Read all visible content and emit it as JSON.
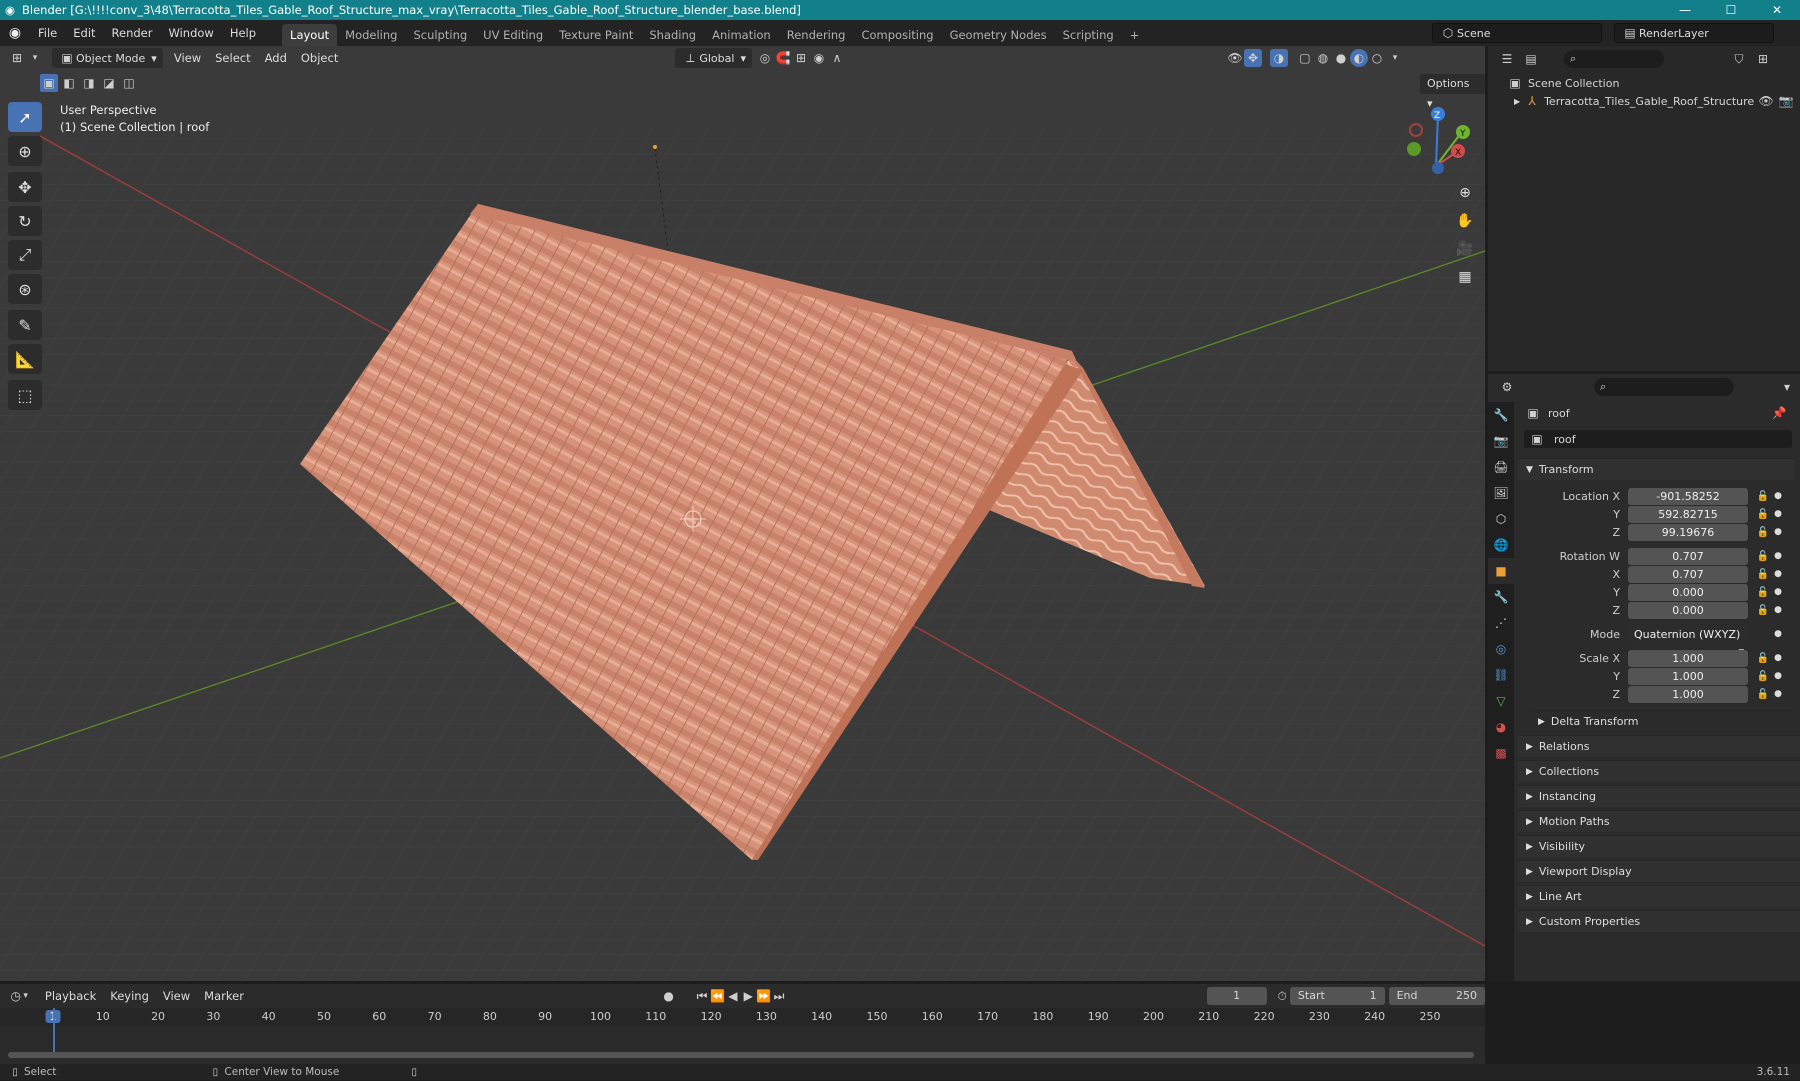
{
  "window": {
    "title": "Blender [G:\\!!!!conv_3\\48\\Terracotta_Tiles_Gable_Roof_Structure_max_vray\\Terracotta_Tiles_Gable_Roof_Structure_blender_base.blend]",
    "minimize": "—",
    "maximize": "☐",
    "close": "✕"
  },
  "menu": [
    "File",
    "Edit",
    "Render",
    "Window",
    "Help"
  ],
  "workspaces": [
    "Layout",
    "Modeling",
    "Sculpting",
    "UV Editing",
    "Texture Paint",
    "Shading",
    "Animation",
    "Rendering",
    "Compositing",
    "Geometry Nodes",
    "Scripting"
  ],
  "add_workspace": "+",
  "scene": "Scene",
  "render_layer": "RenderLayer",
  "viewport": {
    "mode": "Object Mode",
    "menus": [
      "View",
      "Select",
      "Add",
      "Object"
    ],
    "orientation": "Global",
    "options": "Options",
    "info_line1": "User Perspective",
    "info_line2": "(1) Scene Collection | roof"
  },
  "gizmo": {
    "z": "Z",
    "y": "Y",
    "x": "X"
  },
  "outliner": {
    "scene_collection": "Scene Collection",
    "object": "Terracotta_Tiles_Gable_Roof_Structure"
  },
  "properties": {
    "object_name": "roof",
    "data_name": "roof",
    "transform_title": "Transform",
    "location_label": "Location X",
    "loc_x": "-901.58252",
    "loc_y": "592.82715",
    "loc_z": "99.19676",
    "rotation_label": "Rotation W",
    "rot_w": "0.707",
    "rot_x": "0.707",
    "rot_y": "0.000",
    "rot_z": "0.000",
    "mode_label": "Mode",
    "mode_value": "Quaternion (WXYZ)",
    "scale_label": "Scale X",
    "scale_x": "1.000",
    "scale_y": "1.000",
    "scale_z": "1.000",
    "y": "Y",
    "z": "Z",
    "x": "X",
    "delta": "Delta Transform",
    "panels": [
      "Relations",
      "Collections",
      "Instancing",
      "Motion Paths",
      "Visibility",
      "Viewport Display",
      "Line Art",
      "Custom Properties"
    ]
  },
  "timeline": {
    "menus": [
      "Playback",
      "Keying",
      "View",
      "Marker"
    ],
    "current_frame": "1",
    "start_label": "Start",
    "start": "1",
    "end_label": "End",
    "end": "250",
    "ticks": [
      "1",
      "10",
      "20",
      "30",
      "40",
      "50",
      "60",
      "70",
      "80",
      "90",
      "100",
      "110",
      "120",
      "130",
      "140",
      "150",
      "160",
      "170",
      "180",
      "190",
      "200",
      "210",
      "220",
      "230",
      "240",
      "250"
    ]
  },
  "status": {
    "select": "Select",
    "center": "Center View to Mouse",
    "version": "3.6.11"
  },
  "colors": {
    "accent": "#4772b3",
    "title_bar": "#12808a",
    "roof": "#d6917a",
    "x_axis": "#c24242",
    "y_axis": "#6c9a2a"
  }
}
